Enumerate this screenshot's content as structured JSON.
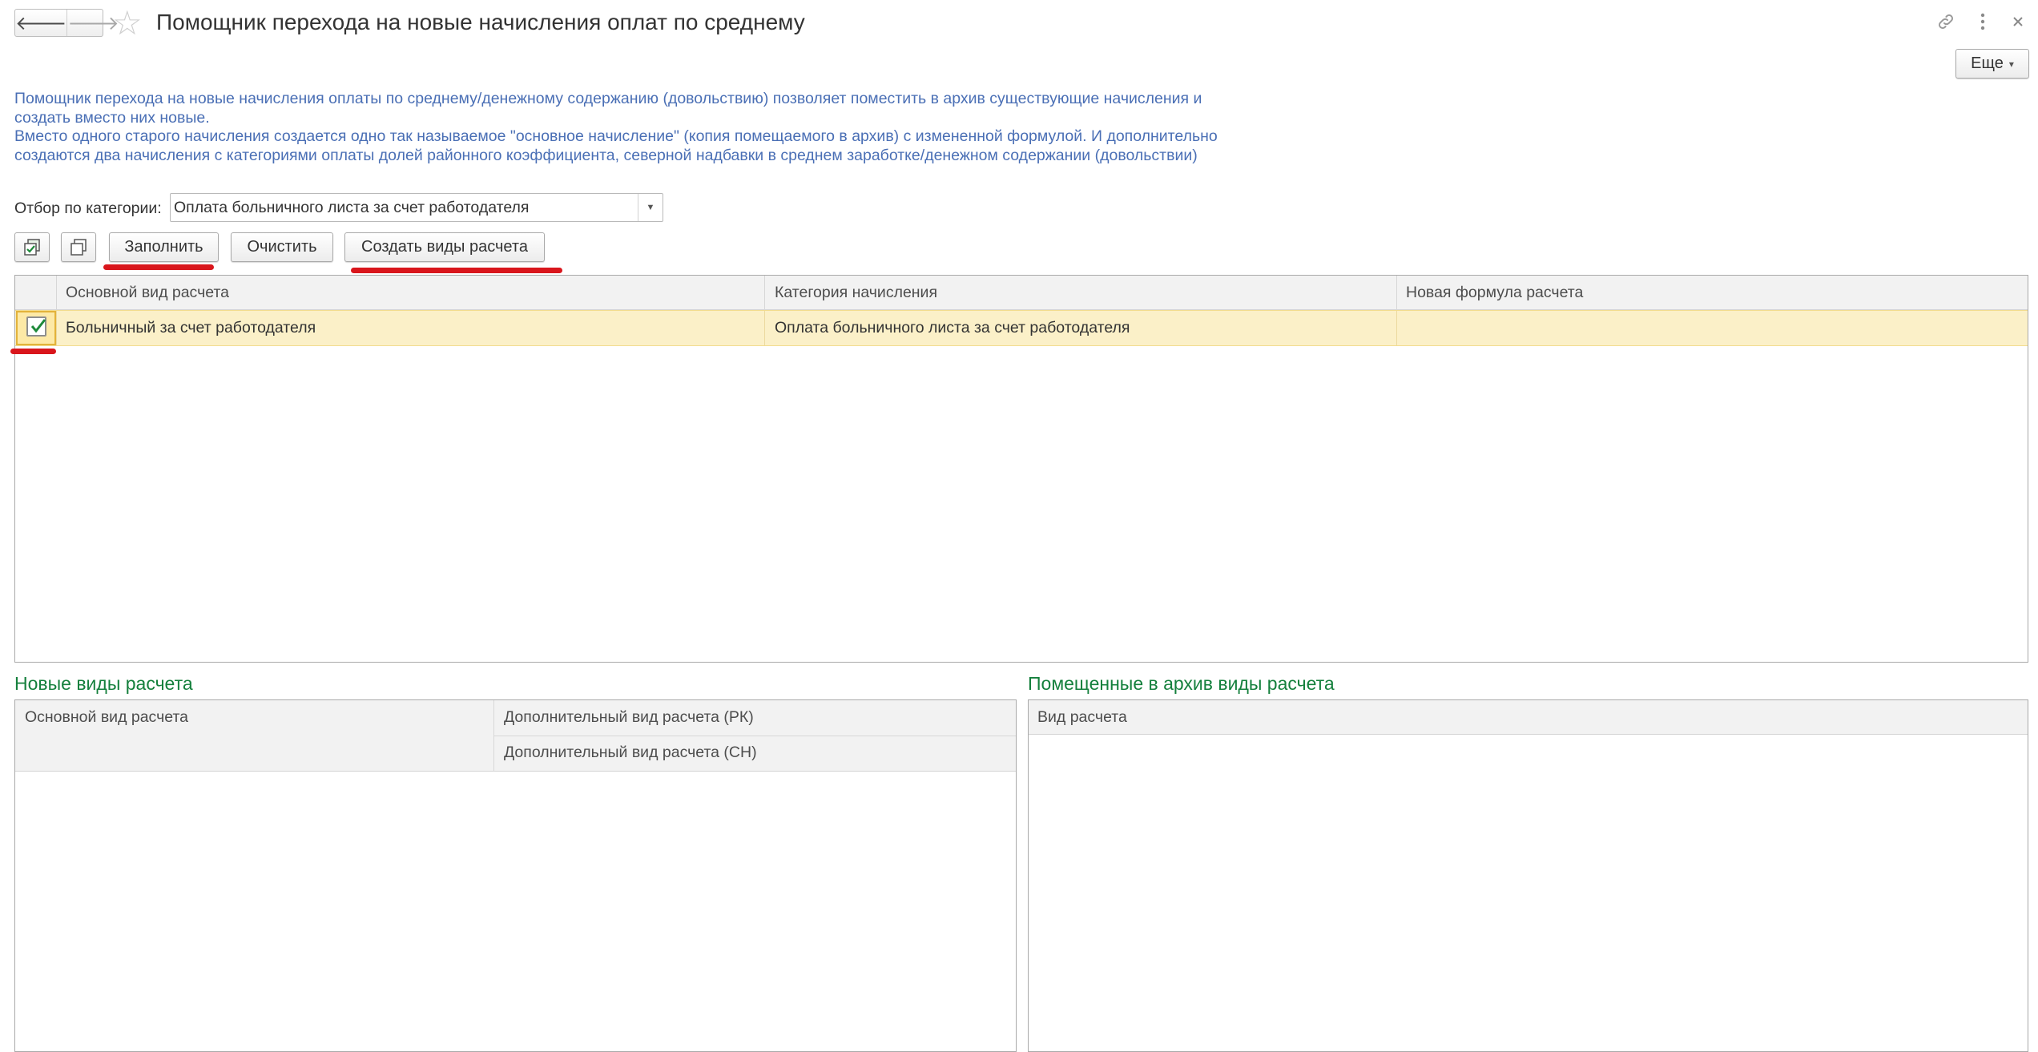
{
  "window": {
    "title": "Помощник перехода на новые начисления оплат по среднему",
    "more_label": "Еще"
  },
  "description": {
    "paragraph1": "Помощник перехода на новые начисления оплаты по среднему/денежному содержанию (довольствию) позволяет поместить в архив существующие начисления и создать вместо них новые.",
    "paragraph2": "Вместо одного старого начисления создается одно так называемое \"основное начисление\" (копия помещаемого в архив) с измененной формулой. И дополнительно создаются два начисления с категориями оплаты долей районного коэффициента, северной надбавки в среднем заработке/денежном содержании (довольствии)"
  },
  "filter": {
    "label": "Отбор по категории:",
    "value": "Оплата больничного листа за счет работодателя"
  },
  "toolbar": {
    "fill_label": "Заполнить",
    "clear_label": "Очистить",
    "create_label": "Создать виды расчета"
  },
  "main_table": {
    "columns": [
      "Основной вид расчета",
      "Категория начисления",
      "Новая формула расчета"
    ],
    "rows": [
      {
        "checked": true,
        "main_type": "Больничный за счет работодателя",
        "category": "Оплата больничного листа за счет работодателя",
        "formula": ""
      }
    ]
  },
  "new_types": {
    "title": "Новые виды расчета",
    "col_main": "Основной вид расчета",
    "col_extra_rk": "Дополнительный вид расчета (РК)",
    "col_extra_sn": "Дополнительный вид расчета (СН)"
  },
  "archived_types": {
    "title": "Помещенные в архив виды расчета",
    "col_type": "Вид расчета"
  },
  "icons": {
    "back": "arrow-left-icon",
    "forward": "arrow-right-icon",
    "favorite": "star-icon",
    "link": "link-icon",
    "menu": "kebab-menu-icon",
    "close": "close-icon",
    "check_all": "check-all-icon",
    "uncheck_all": "uncheck-all-icon"
  },
  "colors": {
    "description_text": "#4a6fb5",
    "section_title": "#15803d",
    "selected_row": "#fbf0c8",
    "annotation": "#d9161c"
  }
}
